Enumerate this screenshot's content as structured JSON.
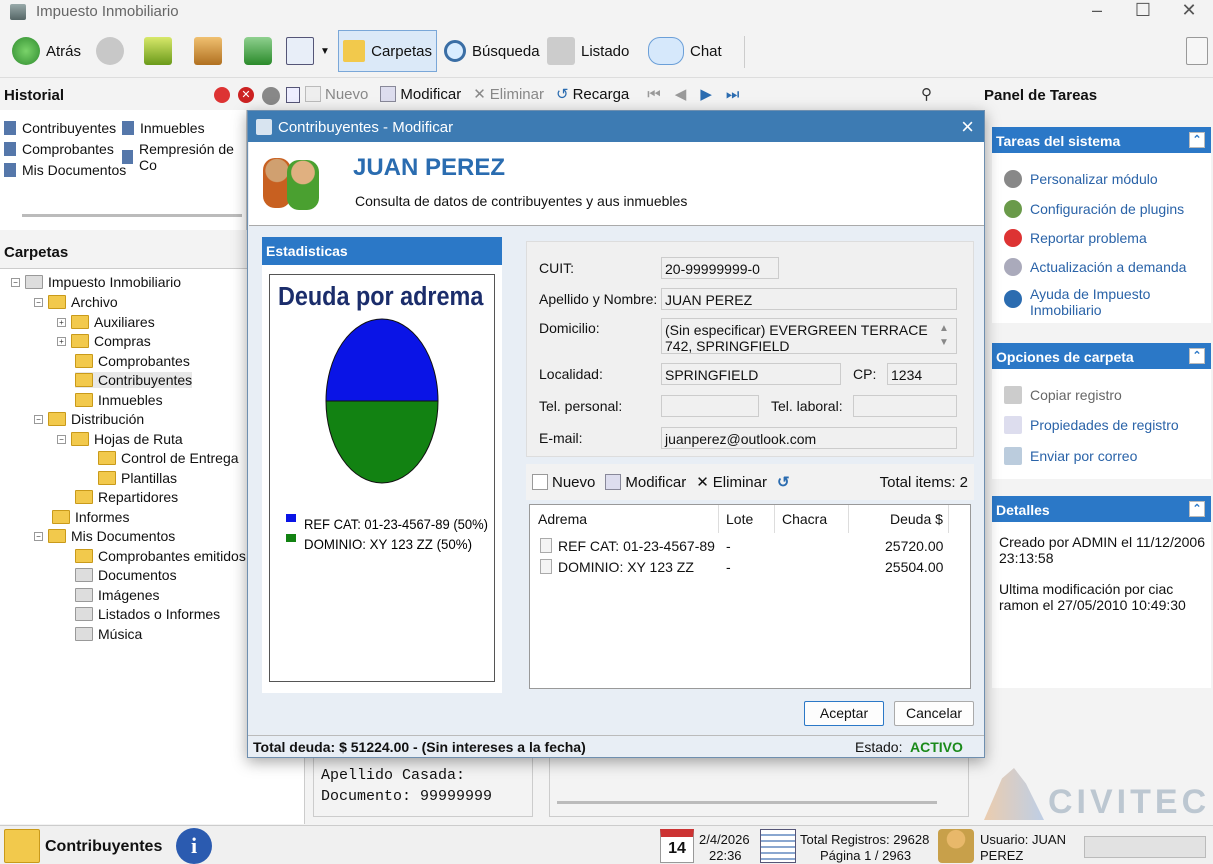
{
  "window": {
    "title": "Impuesto Inmobiliario"
  },
  "toolbar": {
    "back": "Atrás",
    "folders": "Carpetas",
    "search": "Búsqueda",
    "list": "Listado",
    "chat": "Chat"
  },
  "historial": {
    "title": "Historial",
    "items": [
      "Contribuyentes",
      "Inmuebles",
      "Comprobantes",
      "Rempresión de Co",
      "Mis Documentos"
    ]
  },
  "subtoolbar": {
    "new": "Nuevo",
    "edit": "Modificar",
    "delete": "Eliminar",
    "reload": "Recarga"
  },
  "carpetas": {
    "title": "Carpetas",
    "nodes": [
      "Impuesto Inmobiliario",
      "Archivo",
      "Auxiliares",
      "Compras",
      "Comprobantes",
      "Contribuyentes",
      "Inmuebles",
      "Distribución",
      "Hojas de Ruta",
      "Control de Entrega",
      "Plantillas",
      "Repartidores",
      "Informes",
      "Mis Documentos",
      "Comprobantes emitidos",
      "Documentos",
      "Imágenes",
      "Listados o Informes",
      "Música"
    ]
  },
  "background_detail": {
    "line1": "Apellido Casada:",
    "line2": "Documento: 99999999"
  },
  "task_panel": {
    "title": "Panel de Tareas",
    "system": {
      "title": "Tareas del sistema",
      "items": [
        "Personalizar módulo",
        "Configuración de plugins",
        "Reportar problema",
        "Actualización a demanda",
        "Ayuda de Impuesto Inmobiliario"
      ]
    },
    "folder_options": {
      "title": "Opciones de carpeta",
      "items": [
        "Copiar registro",
        "Propiedades de registro",
        "Enviar por correo"
      ]
    },
    "details": {
      "title": "Detalles",
      "created": "Creado por ADMIN el 11/12/2006 23:13:58",
      "modified": "Ultima modificación por ciac ramon el 27/05/2010 10:49:30"
    }
  },
  "brand": {
    "logo_text": "CIVITEC"
  },
  "dialog": {
    "title": "Contribuyentes - Modificar",
    "name": "JUAN PEREZ",
    "subtitle": "Consulta de datos de contribuyentes y aus inmuebles",
    "stats_title": "Estadisticas",
    "form": {
      "cuit_label": "CUIT:",
      "cuit": "20-99999999-0",
      "name_label": "Apellido y Nombre:",
      "name": "JUAN PEREZ",
      "address_label": "Domicilio:",
      "address": "(Sin especificar) EVERGREEN TERRACE 742, SPRINGFIELD",
      "city_label": "Localidad:",
      "city": "SPRINGFIELD",
      "cp_label": "CP:",
      "cp": "1234",
      "tel_personal_label": "Tel. personal:",
      "tel_personal": "",
      "tel_laboral_label": "Tel. laboral:",
      "tel_laboral": "",
      "email_label": "E-mail:",
      "email": "juanperez@outlook.com"
    },
    "grid_toolbar": {
      "new": "Nuevo",
      "edit": "Modificar",
      "delete": "Eliminar",
      "total": "Total items: 2"
    },
    "grid": {
      "headers": [
        "Adrema",
        "Lote",
        "Chacra",
        "Deuda $"
      ],
      "rows": [
        {
          "adrema": "REF CAT: 01-23-4567-89",
          "lote": "-",
          "chacra": "",
          "deuda": "25720.00"
        },
        {
          "adrema": "DOMINIO: XY 123 ZZ",
          "lote": "-",
          "chacra": "",
          "deuda": "25504.00"
        }
      ]
    },
    "buttons": {
      "accept": "Aceptar",
      "cancel": "Cancelar"
    },
    "footer": {
      "total": "Total deuda: $ 51224.00 - (Sin intereses a la fecha)",
      "state_label": "Estado:",
      "state": "ACTIVO"
    }
  },
  "chart_data": {
    "type": "pie",
    "title": "Deuda por adrema",
    "categories": [
      "REF CAT: 01-23-4567-89 (50%)",
      "DOMINIO: XY 123 ZZ (50%)"
    ],
    "values": [
      50,
      50
    ],
    "colors": [
      "#0a14e6",
      "#128212"
    ]
  },
  "statusbar": {
    "module": "Contribuyentes",
    "date": "2/4/2026",
    "time": "22:36",
    "day": "14",
    "records": "Total Registros: 29628",
    "page": "Página 1 / 2963",
    "user": "Usuario: JUAN PEREZ"
  }
}
